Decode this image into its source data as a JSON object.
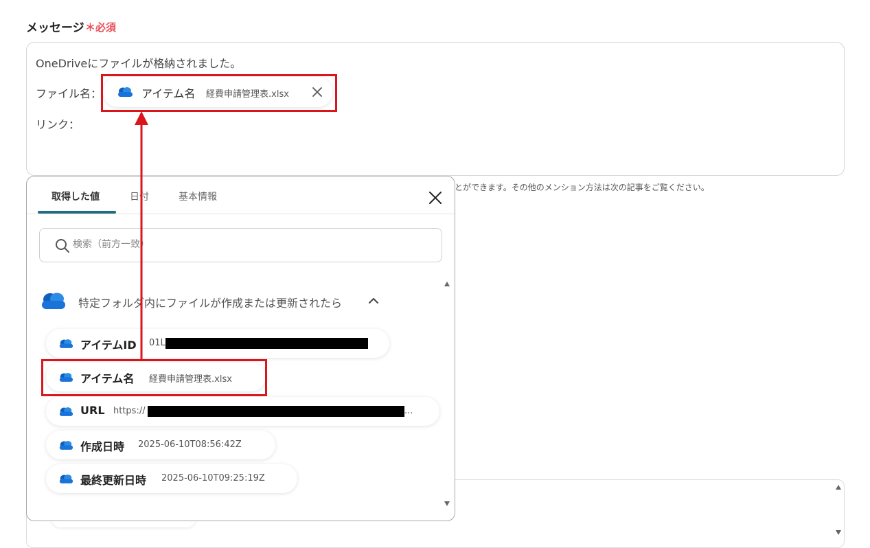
{
  "field": {
    "label": "メッセージ",
    "required": "＊必須"
  },
  "message": {
    "line1": "OneDriveにファイルが格納されました。",
    "line2_label": "ファイル名：",
    "line3_label": "リンク：",
    "chip": {
      "key": "アイテム名",
      "value": "経費申請管理表.xlsx",
      "icon": "onedrive-cloud-icon",
      "remove_icon": "close-icon"
    }
  },
  "help_text": "とができます。その他のメンション方法は次の記事をご覧ください。",
  "popup": {
    "tabs": [
      {
        "label": "取得した値",
        "active": true
      },
      {
        "label": "日付",
        "active": false
      },
      {
        "label": "基本情報",
        "active": false
      }
    ],
    "search": {
      "placeholder": "検索（前方一致）",
      "value": ""
    },
    "group": {
      "title": "特定フォルダ内にファイルが作成または更新されたら",
      "icon": "onedrive-cloud-icon",
      "expanded": true
    },
    "items": [
      {
        "key": "アイテムID",
        "value": "01L"
      },
      {
        "key": "アイテム名",
        "value": "経費申請管理表.xlsx"
      },
      {
        "key": "URL",
        "value": "https://",
        "value_suffix": "..."
      },
      {
        "key": "作成日時",
        "value": "2025-06-10T08:56:42Z"
      },
      {
        "key": "最終更新日時",
        "value": "2025-06-10T09:25:19Z"
      }
    ]
  },
  "colors": {
    "accent_tab": "#1f6d80",
    "required": "#e8505b",
    "annotation_red": "#d9161c",
    "onedrive_blue": "#1a73d9"
  }
}
